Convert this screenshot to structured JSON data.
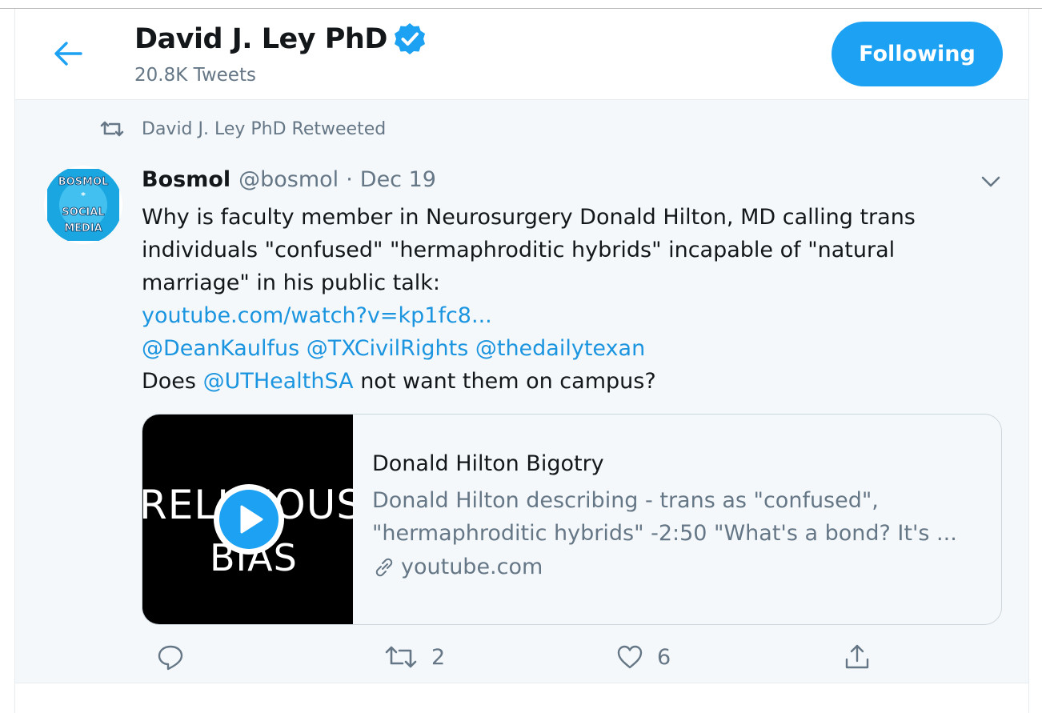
{
  "header": {
    "display_name": "David J. Ley PhD",
    "tweet_count": "20.8K Tweets",
    "follow_label": "Following"
  },
  "tweet": {
    "retweet_context": "David J. Ley PhD Retweeted",
    "author": {
      "name": "Bosmol",
      "handle": "@bosmol",
      "separator": "·",
      "date": "Dec 19",
      "avatar_text": [
        "BOSMOL",
        "*",
        "SOCIAL",
        "MEDIA"
      ]
    },
    "body": {
      "line1": "Why is faculty member in Neurosurgery Donald Hilton, MD calling trans",
      "line2": "individuals \"confused\" \"hermaphroditic hybrids\" incapable of \"natural",
      "line3": "marriage\" in his public talk:",
      "link": "youtube.com/watch?v=kp1fc8...",
      "mentions": [
        "@DeanKaulfus",
        "@TXCivilRights",
        "@thedailytexan"
      ],
      "last_pre": "Does ",
      "last_mention": "@UTHealthSA",
      "last_post": " not want them on campus?"
    },
    "card": {
      "thumb_line1": "RELIGIOUS",
      "thumb_line2": "BIAS",
      "title": "Donald Hilton Bigotry",
      "desc_line1": "Donald Hilton describing - trans as \"confused\",",
      "desc_line2": "\"hermaphroditic hybrids\" -2:50 \"What's a bond? It's ...",
      "domain": "youtube.com"
    },
    "actions": {
      "reply_count": "",
      "retweet_count": "2",
      "like_count": "6"
    }
  },
  "colors": {
    "accent": "#1da1f2",
    "link": "#1b95e0",
    "muted": "#657786",
    "tweet_bg": "#f5f8fa"
  },
  "icons": [
    "back-arrow-icon",
    "verified-badge-icon",
    "retweet-icon",
    "chevron-down-icon",
    "play-icon",
    "link-icon",
    "reply-icon",
    "like-icon",
    "share-icon"
  ]
}
